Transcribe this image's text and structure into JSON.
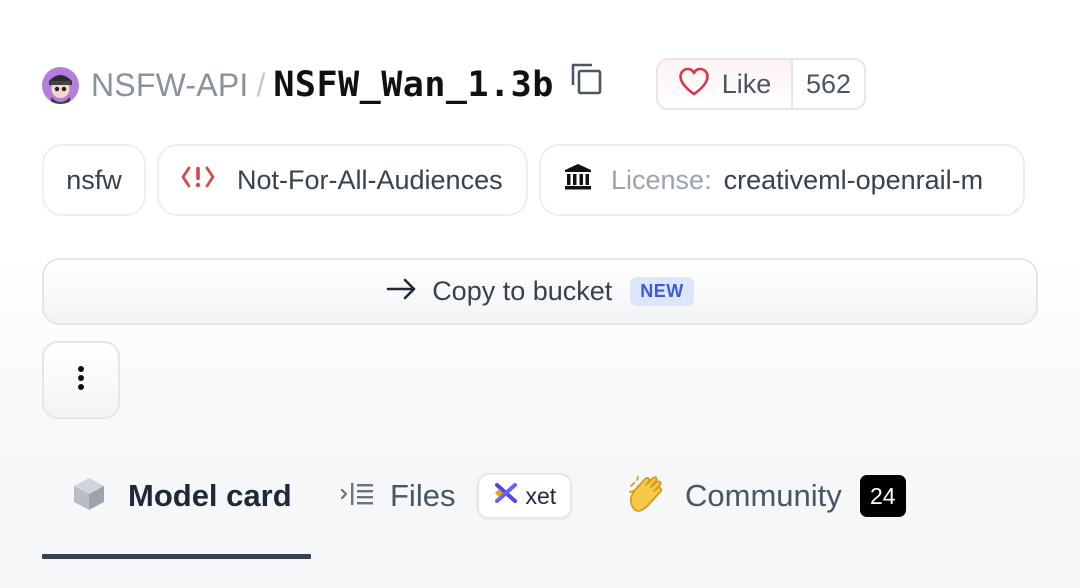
{
  "repo": {
    "owner": "NSFW-API",
    "separator": "/",
    "name": "NSFW_Wan_1.3b"
  },
  "like": {
    "label": "Like",
    "count": "562"
  },
  "tags": {
    "nsfw": "nsfw",
    "audience": "Not-For-All-Audiences",
    "license_key": "License:",
    "license_value": "creativeml-openrail-m"
  },
  "actions": {
    "copy_to_bucket": "Copy to bucket",
    "new_badge": "NEW"
  },
  "tabs": {
    "model_card": "Model card",
    "files": "Files",
    "xet": "xet",
    "community": "Community",
    "community_count": "24"
  },
  "icons": {
    "avatar": "avatar-icon",
    "copy": "copy-icon",
    "heart": "heart-icon",
    "warning": "warning-icon",
    "license": "bank-icon",
    "arrow": "arrow-right-icon",
    "more": "more-vertical-icon",
    "model_card": "cube-icon",
    "files": "files-list-icon",
    "xet": "xet-logo-icon",
    "community": "clapping-hands-icon"
  },
  "colors": {
    "heart": "#d63a4a",
    "warning": "#d24a4a",
    "new_badge_bg": "#dde7fb",
    "new_badge_text": "#3b5bdb",
    "community_badge_bg": "#000000",
    "active_tab_underline": "#374151"
  }
}
